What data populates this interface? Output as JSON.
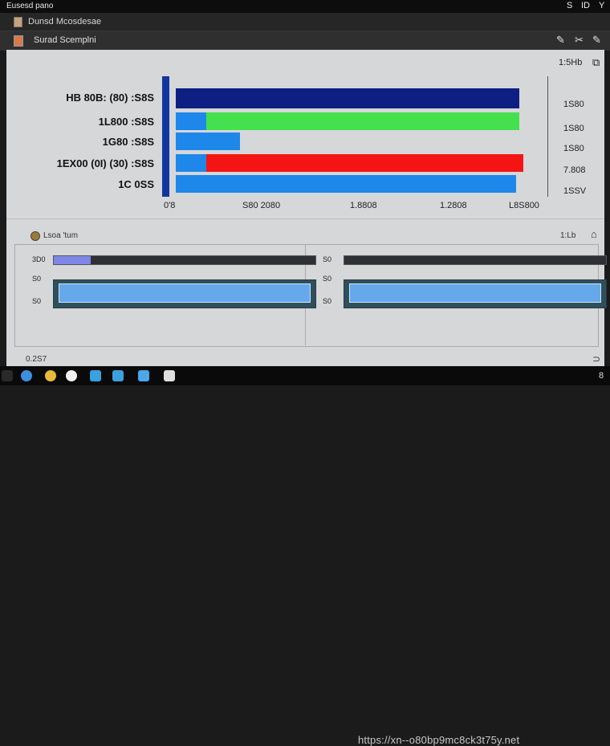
{
  "window": {
    "title": "Eusesd pano",
    "controls": [
      "S",
      "ID",
      "Y"
    ]
  },
  "app": {
    "name": "Dunsd Mcosdesae"
  },
  "tab": {
    "title": "Surad Scemplni",
    "tools": [
      "✎",
      "✂",
      "✎"
    ]
  },
  "chart_data": {
    "type": "bar",
    "orientation": "horizontal",
    "categories": [
      "HB 80B: (80) :S8S",
      "1L800 :S8S",
      "1G80 :S8S",
      "1EX00 (0I) (30) :S8S",
      "1C 0SS"
    ],
    "series": [
      {
        "values": [
          0.96
        ]
      },
      {
        "values": [
          0.96
        ]
      },
      {
        "values": [
          0.18
        ]
      },
      {
        "values": [
          0.97
        ]
      },
      {
        "values": [
          0.95
        ]
      }
    ],
    "segment_colors": [
      "#0d1f82",
      "#44e04e",
      "#1e88ea",
      "#f41414",
      "#1e88ea"
    ],
    "left_segment_color": "#1e88ea",
    "x_ticks": [
      "0'8",
      "S80 2080",
      "1.8808",
      "1.2808",
      "L8S800"
    ],
    "right_labels": [
      "1S80",
      "1S80",
      "1S80",
      "7.808",
      "1SSV"
    ],
    "top_right_label": "1:5Hb"
  },
  "meters": {
    "title": "Lsoa 'tum",
    "right_label": "1:Lb",
    "left": [
      {
        "label": "3D0",
        "level": 0.14
      },
      {
        "label": "S0",
        "level": 1.0
      },
      {
        "label": "S0",
        "level": 1.0
      }
    ],
    "right": [
      {
        "label": "S0",
        "level": 0.0
      },
      {
        "label": "S0",
        "level": 1.0
      },
      {
        "label": "S0",
        "level": 1.0
      }
    ],
    "footer_left": "0.2S7",
    "footer_right": "⊃"
  },
  "taskbar": {
    "watermark": "https://xn--o80bp9mc8ck3t75y.net",
    "clock": "8"
  }
}
